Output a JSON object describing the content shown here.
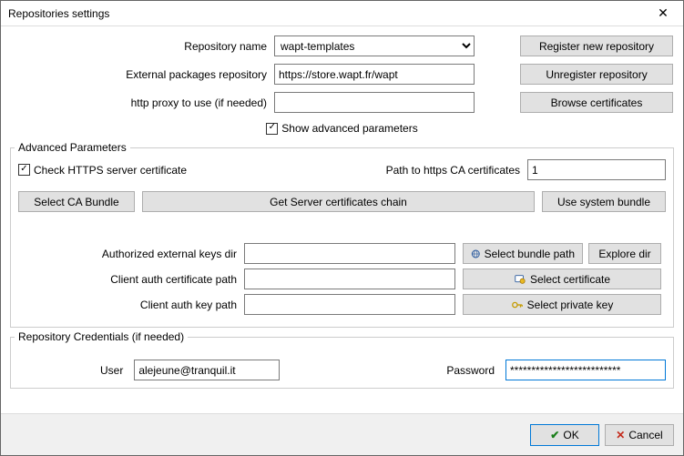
{
  "window": {
    "title": "Repositories settings"
  },
  "top": {
    "repo_name_label": "Repository name",
    "repo_name_value": "wapt-templates",
    "ext_repo_label": "External packages repository",
    "ext_repo_value": "https://store.wapt.fr/wapt",
    "proxy_label": "http proxy to use (if needed)",
    "proxy_value": "",
    "register_btn": "Register new repository",
    "unregister_btn": "Unregister repository",
    "browse_btn": "Browse certificates",
    "show_advanced": "Show advanced parameters"
  },
  "adv": {
    "group_title": "Advanced Parameters",
    "check_https": "Check HTTPS server certificate",
    "path_label": "Path to https CA certificates",
    "path_value": "1",
    "select_ca": "Select CA Bundle",
    "get_chain": "Get Server certificates chain",
    "use_system": "Use system bundle",
    "ext_keys_label": "Authorized external keys dir",
    "ext_keys_value": "",
    "select_bundle": "Select bundle path",
    "explore_dir": "Explore dir",
    "client_cert_label": "Client auth certificate path",
    "client_cert_value": "",
    "select_cert": "Select certificate",
    "client_key_label": "Client auth key path",
    "client_key_value": "",
    "select_key": "Select private key"
  },
  "cred": {
    "group_title": "Repository Credentials (if needed)",
    "user_label": "User",
    "user_value": "alejeune@tranquil.it",
    "password_label": "Password",
    "password_value": "**************************"
  },
  "footer": {
    "ok": "OK",
    "cancel": "Cancel"
  }
}
